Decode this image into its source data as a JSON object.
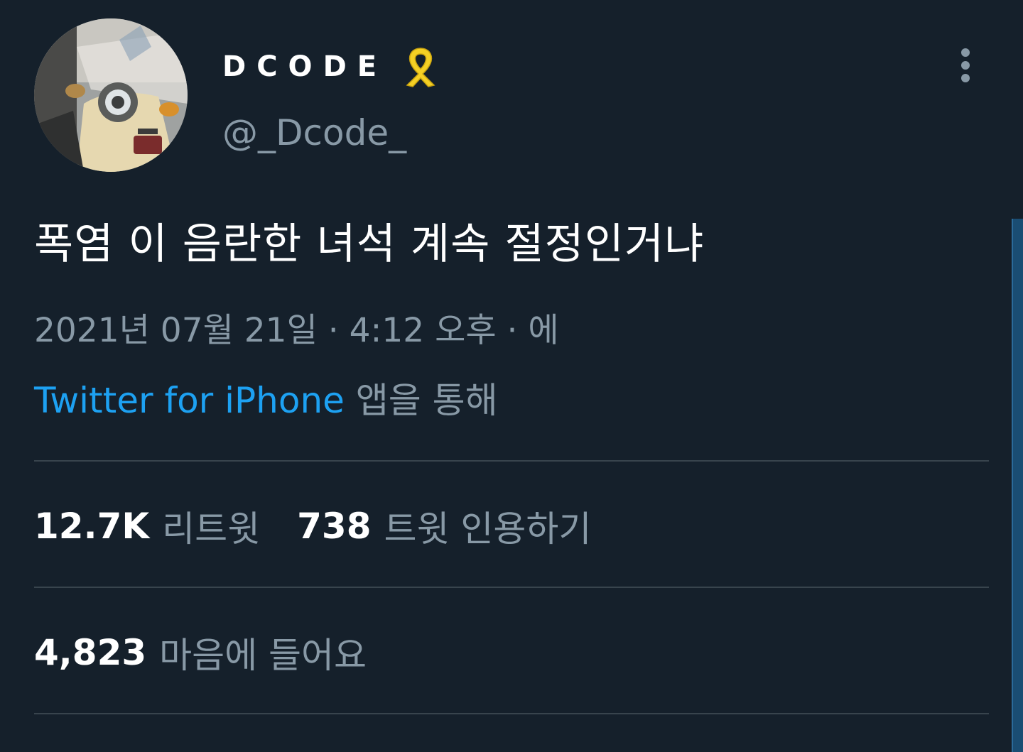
{
  "profile": {
    "display_name": "DCODE",
    "handle": "@_Dcode_",
    "ribbon_icon": "yellow-ribbon-icon",
    "avatar_description_icon": "avatar-motorcycle-photo"
  },
  "more_icon": "vertical-ellipsis-icon",
  "tweet": {
    "text": "폭염 이 음란한 녀석 계속 절정인거냐",
    "meta": "2021년 07월 21일 · 4:12 오후 · 에",
    "source_link": "Twitter for iPhone",
    "source_suffix": " 앱을 통해"
  },
  "stats": {
    "retweets_count": "12.7K",
    "retweets_label": "리트윗",
    "quotes_count": "738",
    "quotes_label": "트윗 인용하기",
    "likes_count": "4,823",
    "likes_label": "마음에 들어요"
  },
  "colors": {
    "background": "#15202b",
    "secondary_text": "#8899a6",
    "link": "#1da1f2",
    "divider": "#38444d",
    "ribbon": "#f5d024"
  }
}
